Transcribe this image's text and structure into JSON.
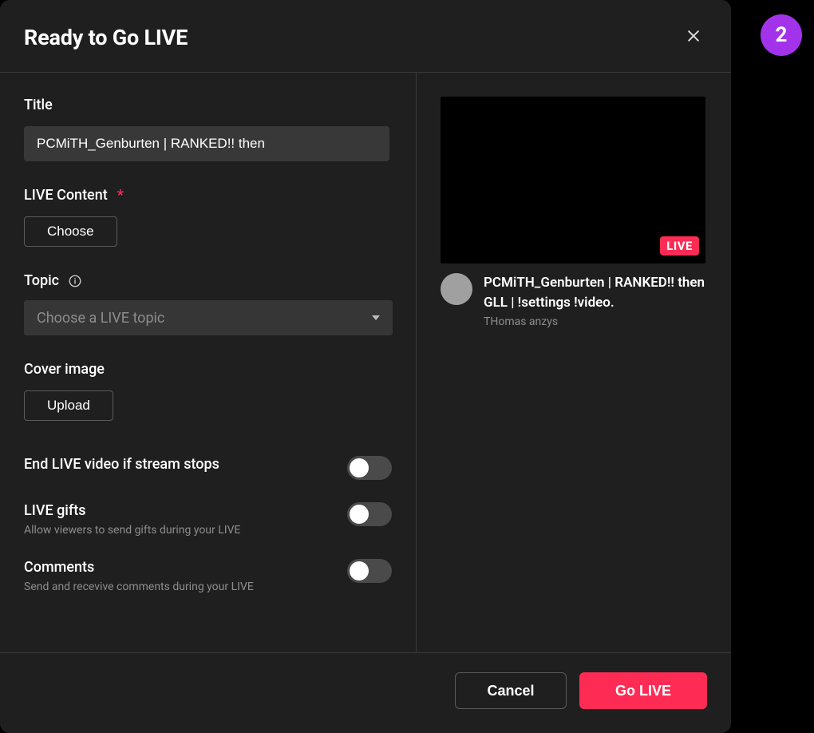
{
  "step_badge": "2",
  "dialog": {
    "title": "Ready to Go LIVE",
    "fields": {
      "title": {
        "label": "Title",
        "value": "PCMiTH_Genburten | RANKED!! then"
      },
      "live_content": {
        "label": "LIVE Content",
        "required_mark": "*",
        "button": "Choose"
      },
      "topic": {
        "label": "Topic",
        "placeholder": "Choose a LIVE topic"
      },
      "cover_image": {
        "label": "Cover image",
        "button": "Upload"
      }
    },
    "toggles": {
      "end_on_stop": {
        "title": "End LIVE video if stream stops"
      },
      "gifts": {
        "title": "LIVE gifts",
        "sub": "Allow viewers to send gifts during your LIVE"
      },
      "comments": {
        "title": "Comments",
        "sub": "Send and recevive comments during your LIVE"
      }
    },
    "preview": {
      "live_badge": "LIVE",
      "title": "PCMiTH_Genburten | RANKED!! then GLL | !settings !video.",
      "user": "THomas anzys"
    },
    "footer": {
      "cancel": "Cancel",
      "go_live": "Go LIVE"
    }
  }
}
